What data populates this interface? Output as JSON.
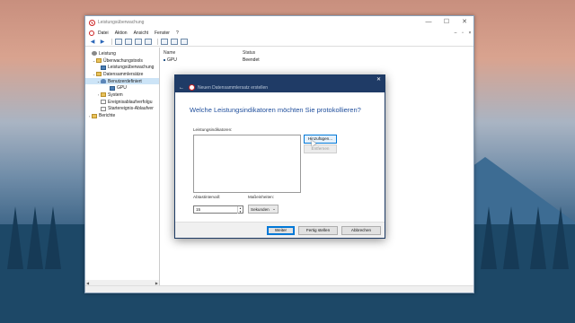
{
  "window": {
    "title": "Leistungsüberwachung",
    "controls": [
      "—",
      "☐",
      "✕"
    ]
  },
  "menu": {
    "items": [
      "Datei",
      "Aktion",
      "Ansicht",
      "Fenster",
      "?"
    ],
    "right_controls": [
      "–",
      "▫",
      "×"
    ]
  },
  "toolbar": {
    "icons": [
      "back-icon",
      "forward-icon",
      "up-icon",
      "properties-icon",
      "refresh-icon",
      "help-icon",
      "console-icon"
    ]
  },
  "tree": {
    "items": [
      {
        "label": "Leistung",
        "indent": 0,
        "toggle": "",
        "icon": "gear"
      },
      {
        "label": "Überwachungstools",
        "indent": 1,
        "toggle": "⌄",
        "icon": "fold"
      },
      {
        "label": "Leistungsüberwachung",
        "indent": 2,
        "toggle": "",
        "icon": "mon"
      },
      {
        "label": "Datensammlersätze",
        "indent": 1,
        "toggle": "⌄",
        "icon": "fold"
      },
      {
        "label": "Benutzerdefiniert",
        "indent": 2,
        "toggle": "⌄",
        "icon": "user",
        "selected": true
      },
      {
        "label": "GPU",
        "indent": 3,
        "toggle": "",
        "icon": "mon"
      },
      {
        "label": "System",
        "indent": 2,
        "toggle": "›",
        "icon": "fold"
      },
      {
        "label": "Ereignisablaufverfolgu",
        "indent": 2,
        "toggle": "",
        "icon": "doc"
      },
      {
        "label": "Startereignis-Ablaufver",
        "indent": 2,
        "toggle": "",
        "icon": "doc"
      },
      {
        "label": "Berichte",
        "indent": 1,
        "toggle": "›",
        "icon": "fold"
      }
    ]
  },
  "list": {
    "headers": [
      "Name",
      "Status"
    ],
    "rows": [
      {
        "name": "GPU",
        "status": "Beendet"
      }
    ]
  },
  "dialog": {
    "title": "Neuen Datensammlersatz erstellen",
    "question": "Welche Leistungsindikatoren möchten Sie protokollieren?",
    "counters_label": "Leistungsindikatoren:",
    "add_button": "Hinzufügen...",
    "remove_button": "Entfernen",
    "interval_label": "Abtastintervall:",
    "interval_value": "15",
    "units_label": "Maßeinheiten:",
    "units_value": "Sekunden",
    "next_button": "Weiter",
    "finish_button": "Fertig stellen",
    "cancel_button": "Abbrechen"
  }
}
